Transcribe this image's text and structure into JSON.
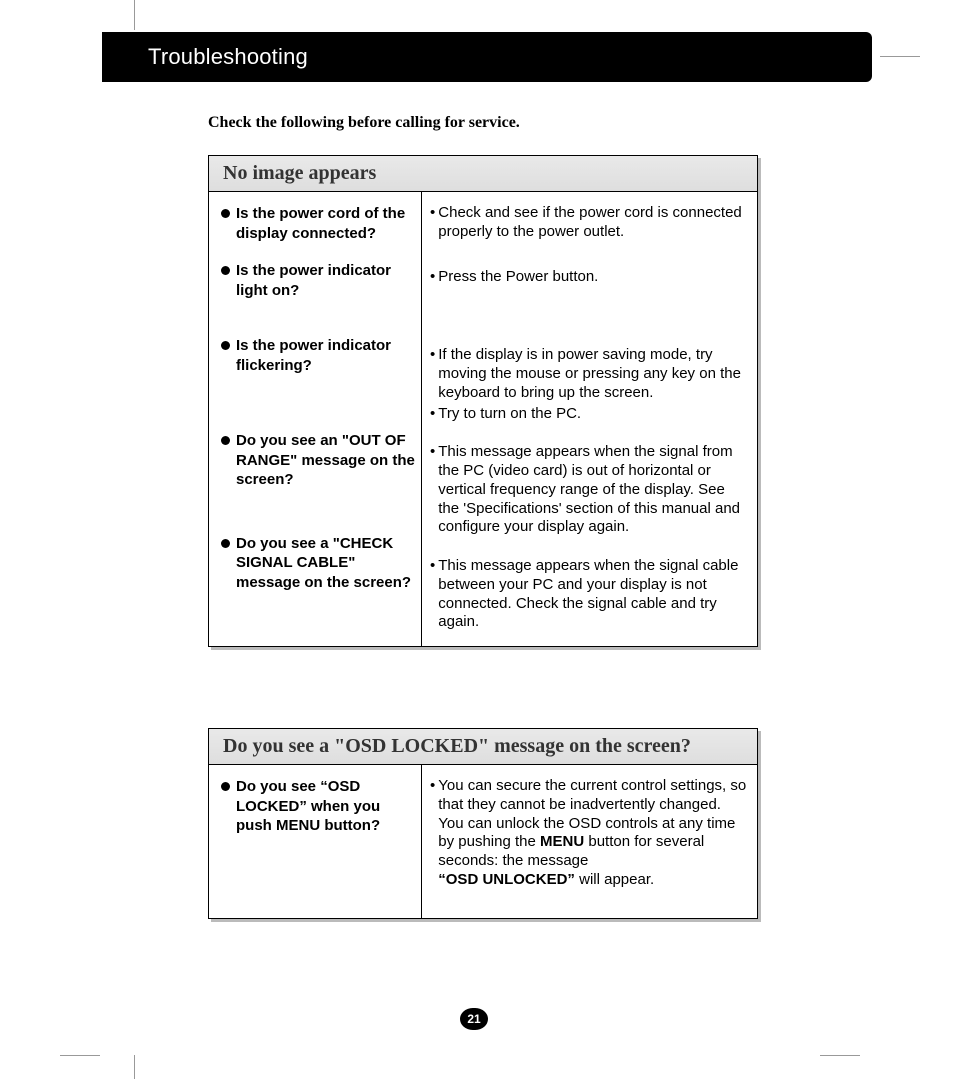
{
  "header": {
    "title": "Troubleshooting"
  },
  "intro": "Check the following before calling for service.",
  "box1": {
    "heading": "No image appears",
    "rows": [
      {
        "q": "Is the power cord of the display connected?",
        "a": [
          "Check and see if the power cord is connected properly to the power outlet."
        ]
      },
      {
        "q": "Is the power indicator light on?",
        "a": [
          "Press the Power button."
        ]
      },
      {
        "q": "Is the power indicator flickering?",
        "a": [
          "If the display is in power saving mode, try moving the mouse or pressing any key on the keyboard to bring up the screen.",
          "Try to turn on the PC."
        ]
      },
      {
        "q": "Do you see an \"OUT OF RANGE\" message on the screen?",
        "a": [
          "This message appears when the signal from the PC (video card) is out of horizontal or vertical frequency range of the display. See the 'Specifications' section of this manual and configure your display again."
        ]
      },
      {
        "q": "Do you see a \"CHECK SIGNAL CABLE\" message on the screen?",
        "a": [
          "This message appears when the signal cable between your PC and your display is not connected. Check the signal cable and try again."
        ]
      }
    ]
  },
  "box2": {
    "heading": "Do you see a \"OSD LOCKED\" message on the screen?",
    "q": "Do you see “OSD LOCKED” when you push MENU button?",
    "a_pre": "You can secure the current control settings, so that they cannot be inadvertently changed. You can unlock the OSD controls at any time by pushing the ",
    "a_b1": "MENU",
    "a_mid": " button for several seconds: the message ",
    "a_b2": "“OSD UNLOCKED”",
    "a_post": " will appear."
  },
  "page_number": "21"
}
